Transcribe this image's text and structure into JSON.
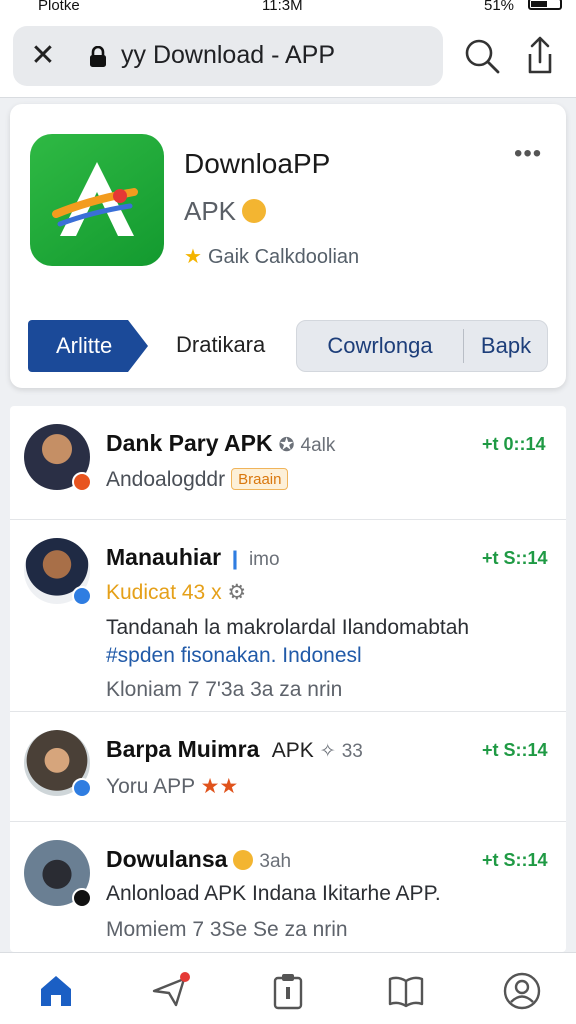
{
  "status_bar": {
    "carrier": "Plotke",
    "time": "11:3M",
    "battery": "51%"
  },
  "url_bar": {
    "text": "yy Download - APP"
  },
  "app_card": {
    "name": "DownloaPP",
    "subtitle": "APK",
    "rating_label": "Gaik Calkdoolian",
    "tabs": {
      "active": "Arlitte",
      "second": "Dratikara"
    },
    "buttons": {
      "primary": "Cowrlonga",
      "secondary": "Bapk"
    }
  },
  "feed": [
    {
      "title": "Dank Pary APK",
      "meta": "4alk",
      "time": "+t 0::14",
      "lines": [
        "Andoalogddr"
      ],
      "tag": "Braain",
      "badge_color": "#e8541f"
    },
    {
      "title": "Manauhiar",
      "meta": "imo",
      "time": "+t S::14",
      "kudos": "Kudicat 43 x",
      "lines": [
        "Tandanah la makrolardal Ilandomabtah",
        "#spden fisonakan. Indonesl",
        "Kloniam 7 7'3a 3a za nrin"
      ],
      "badge_color": "#2f7de1"
    },
    {
      "title": "Barpa Muimra",
      "title_suffix": "APK",
      "meta": "33",
      "time": "+t S::14",
      "lines": [
        "Yoru APP"
      ],
      "badge_color": "#2f7de1"
    },
    {
      "title": "Dowulansa",
      "meta": "3ah",
      "time": "+t S::14",
      "lines": [
        "Anlonload APK Indana Ikitarhe APP.",
        "Momiem 7 3Se Se za nrin"
      ],
      "badge_color": "#111111"
    }
  ],
  "bottom_nav": {
    "items": [
      "home-icon",
      "send-icon",
      "clipboard-icon",
      "book-icon",
      "profile-icon"
    ],
    "active_color": "#1b5fc4"
  }
}
